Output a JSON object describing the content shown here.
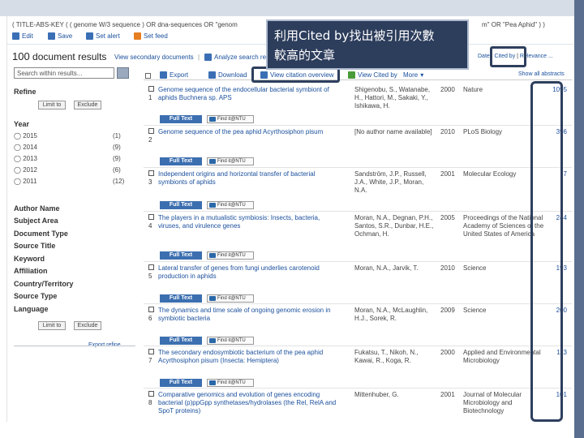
{
  "query_text": "( TITLE-ABS-KEY ( ( genome W/3 sequence ) OR dna-sequences OR \"genom",
  "query_suffix": "m\" OR \"Pea Aphid\" ) )",
  "toolbar": {
    "edit": "Edit",
    "save": "Save",
    "set_alert": "Set alert",
    "set_feed": "Set feed"
  },
  "results": {
    "count": "100",
    "label": "document results",
    "view_secondary": "View secondary documents",
    "analyze": "Analyze search results"
  },
  "search_within_placeholder": "Search within results...",
  "refine": {
    "title": "Refine",
    "limit_to": "Limit to",
    "exclude": "Exclude"
  },
  "year_facet": {
    "title": "Year",
    "items": [
      {
        "year": "2015",
        "count": "(1)"
      },
      {
        "year": "2014",
        "count": "(9)"
      },
      {
        "year": "2013",
        "count": "(9)"
      },
      {
        "year": "2012",
        "count": "(6)"
      },
      {
        "year": "2011",
        "count": "(12)"
      }
    ]
  },
  "facets": [
    "Author Name",
    "Subject Area",
    "Document Type",
    "Source Title",
    "Keyword",
    "Affiliation",
    "Country/Territory",
    "Source Type",
    "Language"
  ],
  "export_refine": "Export refine",
  "result_actions": {
    "export": "Export",
    "download": "Download",
    "view_citation_overview": "View citation overview",
    "view_cited_by": "View Cited by",
    "more": "More"
  },
  "sort": {
    "label": "Sort on:",
    "date": "Date",
    "cited_by": "Cited by",
    "relevance": "Relevance"
  },
  "show_all_abstracts": "Show all abstracts",
  "full_text_label": "Full Text",
  "find_it_label": "Find it@NTU",
  "rows": [
    {
      "num": "1",
      "title": "Genome sequence of the endocellular bacterial symbiont of aphids Buchnera sp. APS",
      "authors": "Shigenobu, S., Watanabe, H., Hattori, M., Sakaki, Y., Ishikawa, H.",
      "year": "2000",
      "source": "Nature",
      "cited": "1095"
    },
    {
      "num": "2",
      "title": "Genome sequence of the pea aphid Acyrthosiphon pisum",
      "authors": "[No author name available]",
      "year": "2010",
      "source": "PLoS Biology",
      "cited": "396"
    },
    {
      "num": "3",
      "title": "Independent origins and horizontal transfer of bacterial symbionts of aphids",
      "authors": "Sandström, J.P., Russell, J.A., White, J.P., Moran, N.A.",
      "year": "2001",
      "source": "Molecular Ecology",
      "cited": "7"
    },
    {
      "num": "4",
      "title": "The players in a mutualistic symbiosis: Insects, bacteria, viruses, and virulence genes",
      "authors": "Moran, N.A., Degnan, P.H., Santos, S.R., Dunbar, H.E., Ochman, H.",
      "year": "2005",
      "source": "Proceedings of the National Academy of Sciences of the United States of America",
      "cited": "244"
    },
    {
      "num": "5",
      "title": "Lateral transfer of genes from fungi underlies carotenoid production in aphids",
      "authors": "Moran, N.A., Jarvik, T.",
      "year": "2010",
      "source": "Science",
      "cited": "193"
    },
    {
      "num": "6",
      "title": "The dynamics and time scale of ongoing genomic erosion in symbiotic bacteria",
      "authors": "Moran, N.A., McLaughlin, H.J., Sorek, R.",
      "year": "2009",
      "source": "Science",
      "cited": "200"
    },
    {
      "num": "7",
      "title": "The secondary endosymbiotic bacterium of the pea aphid Acyrthosiphon pisum (Insecta: Hemiptera)",
      "authors": "Fukatsu, T., Nikoh, N., Kawai, R., Koga, R.",
      "year": "2000",
      "source": "Applied and Environmental Microbiology",
      "cited": "113"
    },
    {
      "num": "8",
      "title": "Comparative genomics and evolution of genes encoding bacterial (p)ppGpp synthetases/hydrolases (the Rel, RelA and SpoT proteins)",
      "authors": "Mittenhuber, G.",
      "year": "2001",
      "source": "Journal of Molecular Microbiology and Biotechnology",
      "cited": "101"
    }
  ],
  "callout": {
    "line1": "利用Cited by找出被引用次數",
    "line2": "較高的文章"
  },
  "colors": {
    "link": "#1a4f9c",
    "callout_bg": "#2d3d5c",
    "highlight_border": "#2e3f5e",
    "slide_bar": "#5a6f8f"
  }
}
